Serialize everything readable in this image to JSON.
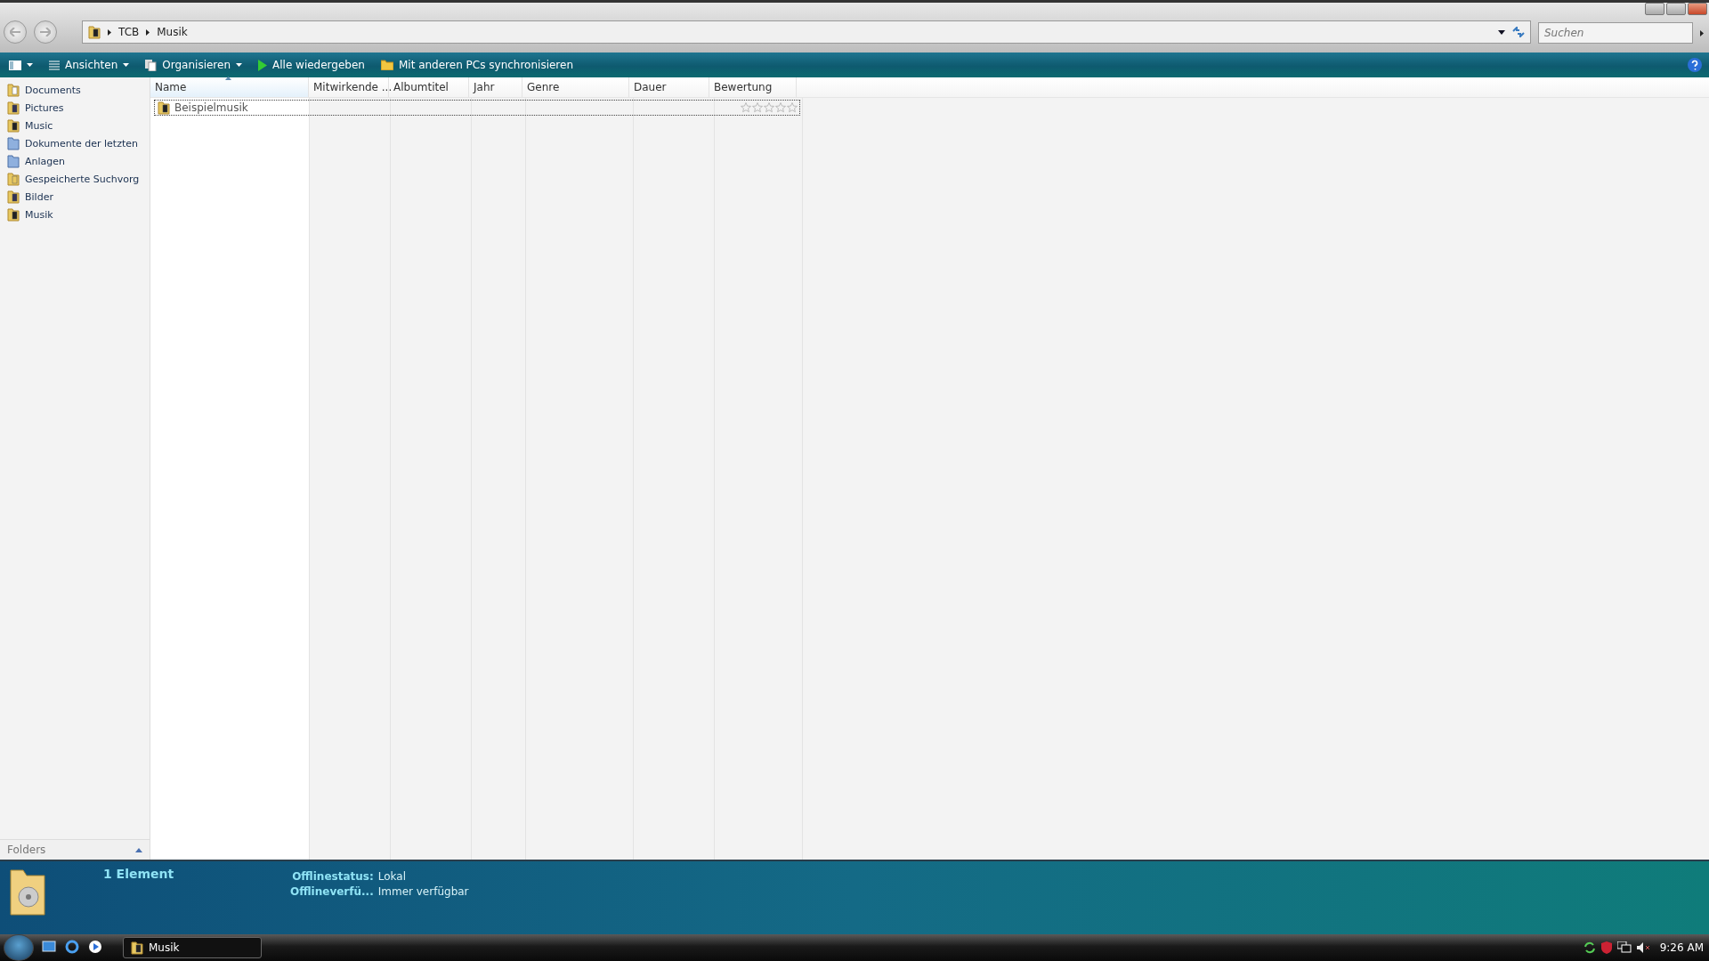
{
  "address_bar": {
    "segments": [
      "TCB",
      "Musik"
    ]
  },
  "search": {
    "placeholder": "Suchen"
  },
  "toolbar": {
    "items": [
      {
        "kind": "views",
        "label": "Ansichten",
        "dropdown": true
      },
      {
        "kind": "organize",
        "label": "Organisieren",
        "dropdown": true
      },
      {
        "kind": "play",
        "label": "Alle wiedergeben",
        "dropdown": false
      },
      {
        "kind": "sync",
        "label": "Mit anderen PCs synchronisieren",
        "dropdown": false
      }
    ]
  },
  "sidebar": {
    "items": [
      {
        "label": "Documents",
        "kind": "documents"
      },
      {
        "label": "Pictures",
        "kind": "pictures"
      },
      {
        "label": "Music",
        "kind": "music"
      },
      {
        "label": "Dokumente der letzten",
        "kind": "library"
      },
      {
        "label": "Anlagen",
        "kind": "library"
      },
      {
        "label": "Gespeicherte Suchvorg",
        "kind": "search"
      },
      {
        "label": "Bilder",
        "kind": "pictures"
      },
      {
        "label": "Musik",
        "kind": "music"
      }
    ],
    "folders_label": "Folders"
  },
  "table": {
    "columns": [
      {
        "label": "Name",
        "sorted": true
      },
      {
        "label": "Mitwirkende ...",
        "sorted": false
      },
      {
        "label": "Albumtitel",
        "sorted": false
      },
      {
        "label": "Jahr",
        "sorted": false
      },
      {
        "label": "Genre",
        "sorted": false
      },
      {
        "label": "Dauer",
        "sorted": false
      },
      {
        "label": "Bewertung",
        "sorted": false
      }
    ],
    "rows": [
      {
        "name": "Beispielmusik",
        "stars": 0,
        "focused": true
      }
    ]
  },
  "details": {
    "title": "1 Element",
    "properties": [
      {
        "label": "Offlinestatus:",
        "value": "Lokal"
      },
      {
        "label": "Offlineverfü...",
        "value": "Immer verfügbar"
      }
    ]
  },
  "taskbar": {
    "window": "Musik",
    "clock": "9:26 AM"
  }
}
